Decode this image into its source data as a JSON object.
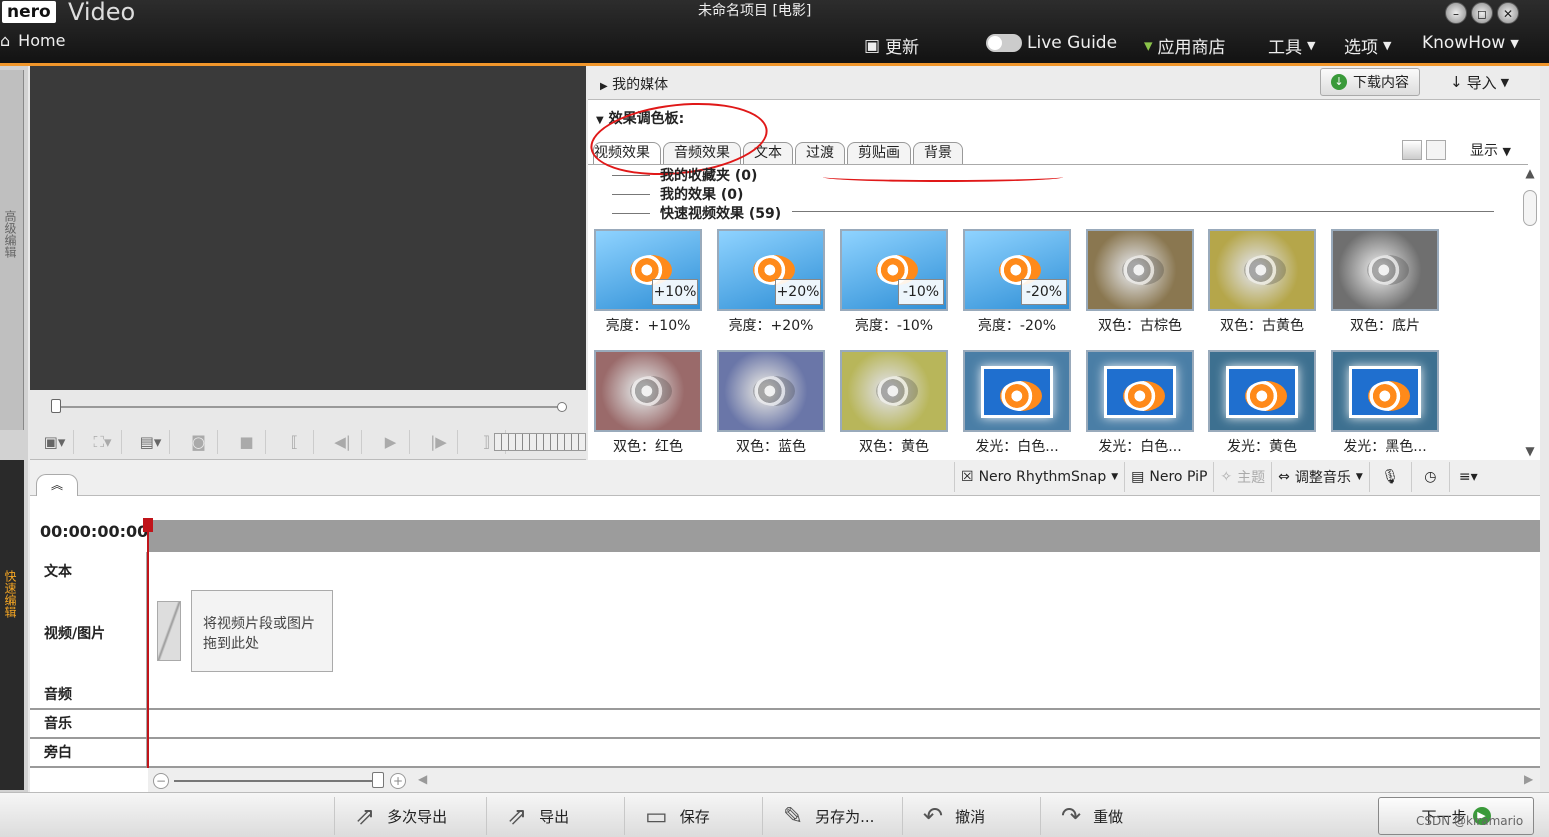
{
  "window": {
    "brand": "nero",
    "app_name": "Video",
    "title": "未命名项目 [电影]",
    "controls": [
      "–",
      "◻",
      "✕"
    ]
  },
  "menubar": {
    "home": "Home",
    "update": "更新",
    "live_guide": "Live Guide",
    "store": "应用商店",
    "tools": "工具",
    "options": "选项",
    "knowhow": "KnowHow"
  },
  "side_tabs": {
    "advanced": "高级编辑",
    "quick": "快速编辑"
  },
  "media": {
    "my_media": "我的媒体",
    "download": "下载内容",
    "import": "导入"
  },
  "effects": {
    "header": "效果调色板:",
    "tabs": [
      "视频效果",
      "音频效果",
      "文本",
      "过渡",
      "剪贴画",
      "背景"
    ],
    "display": "显示",
    "sections": [
      "我的收藏夹 (0)",
      "我的效果 (0)",
      "快速视频效果 (59)"
    ],
    "items": [
      {
        "label": "亮度：+10%",
        "badge": "+10%",
        "style": "brightness"
      },
      {
        "label": "亮度：+20%",
        "badge": "+20%",
        "style": "brightness"
      },
      {
        "label": "亮度：-10%",
        "badge": "-10%",
        "style": "brightness"
      },
      {
        "label": "亮度：-20%",
        "badge": "-20%",
        "style": "brightness"
      },
      {
        "label": "双色：古棕色",
        "badge": "",
        "style": "duo",
        "color": "#8a7750"
      },
      {
        "label": "双色：古黄色",
        "badge": "",
        "style": "duo",
        "color": "#b5a64a"
      },
      {
        "label": "双色：底片",
        "badge": "",
        "style": "duo",
        "color": "#6f6f6f"
      },
      {
        "label": "双色：红色",
        "badge": "",
        "style": "duo",
        "color": "#9a6a6a"
      },
      {
        "label": "双色：蓝色",
        "badge": "",
        "style": "duo",
        "color": "#6a76a8"
      },
      {
        "label": "双色：黄色",
        "badge": "",
        "style": "duo",
        "color": "#b8b65a"
      },
      {
        "label": "发光：白色...",
        "badge": "",
        "style": "glow",
        "color": "#4a7ea6"
      },
      {
        "label": "发光：白色...",
        "badge": "",
        "style": "glow",
        "color": "#4a7ea6"
      },
      {
        "label": "发光：黄色",
        "badge": "",
        "style": "glow",
        "color": "#3d7090"
      },
      {
        "label": "发光：黑色...",
        "badge": "",
        "style": "glow",
        "color": "#3d7090"
      }
    ]
  },
  "tools": {
    "rhythmsnap": "Nero RhythmSnap",
    "pip": "Nero PiP",
    "theme": "主题",
    "adjust_music": "调整音乐"
  },
  "timeline": {
    "timecode": "00:00:00:00",
    "tracks": [
      "文本",
      "视频/图片",
      "音频",
      "音乐",
      "旁白"
    ],
    "drop_hint_line1": "将视频片段或图片",
    "drop_hint_line2": "拖到此处"
  },
  "bottom": {
    "multi_export": "多次导出",
    "export": "导出",
    "save": "保存",
    "save_as": "另存为...",
    "undo": "撤消",
    "redo": "重做",
    "next": "下一步"
  },
  "credit": "CSDN @kiramario",
  "colors": {
    "accent_orange": "#f0962b",
    "annotation_red": "#e01818",
    "playhead_red": "#c0141a"
  }
}
